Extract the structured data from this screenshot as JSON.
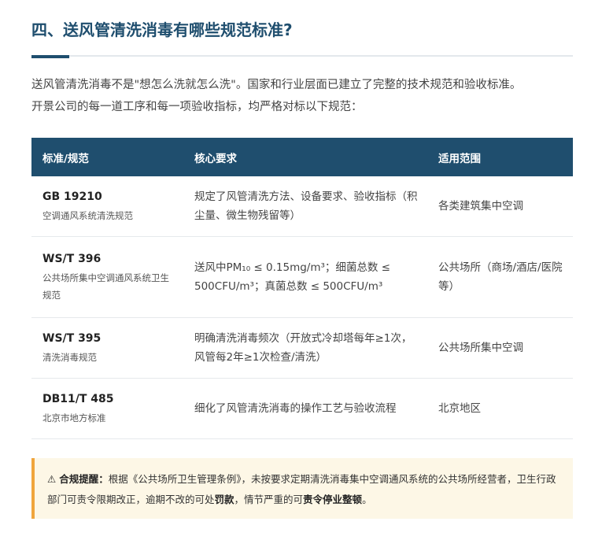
{
  "section": {
    "title": "四、送风管清洗消毒有哪些规范标准?"
  },
  "intro": {
    "line1": "送风管清洗消毒不是\"想怎么洗就怎么洗\"。国家和行业层面已建立了完整的技术规范和验收标准。",
    "line2": "开景公司的每一道工序和每一项验收指标，均严格对标以下规范："
  },
  "table": {
    "headers": [
      "标准/规范",
      "核心要求",
      "适用范围"
    ],
    "rows": [
      {
        "code": "GB 19210",
        "name": "空调通风系统清洗规范",
        "requirement": "规定了风管清洗方法、设备要求、验收指标（积尘量、微生物残留等）",
        "scope": "各类建筑集中空调"
      },
      {
        "code": "WS/T 396",
        "name": "公共场所集中空调通风系统卫生规范",
        "requirement": "送风中PM₁₀ ≤ 0.15mg/m³；细菌总数 ≤ 500CFU/m³；真菌总数 ≤ 500CFU/m³",
        "scope": "公共场所（商场/酒店/医院等）"
      },
      {
        "code": "WS/T 395",
        "name": "清洗消毒规范",
        "requirement": "明确清洗消毒频次（开放式冷却塔每年≥1次，风管每2年≥1次检查/清洗）",
        "scope": "公共场所集中空调"
      },
      {
        "code": "DB11/T 485",
        "name": "北京市地方标准",
        "requirement": "细化了风管清洗消毒的操作工艺与验收流程",
        "scope": "北京地区"
      }
    ]
  },
  "notice": {
    "icon": "⚠",
    "label": "合规提醒：",
    "text_before": "根据《公共场所卫生管理条例》，未按要求定期清洗消毒集中空调通风系统的公共场所经营者，卫生行政部门可责令限期改正，逾期不改的可处",
    "penalty1": "罚款",
    "text_middle": "，情节严重的可",
    "penalty2": "责令停业整顿",
    "text_end": "。"
  },
  "colors": {
    "primary": "#1f4e6e",
    "notice_bg": "#fdf7e6",
    "notice_border": "#f0a53c"
  }
}
